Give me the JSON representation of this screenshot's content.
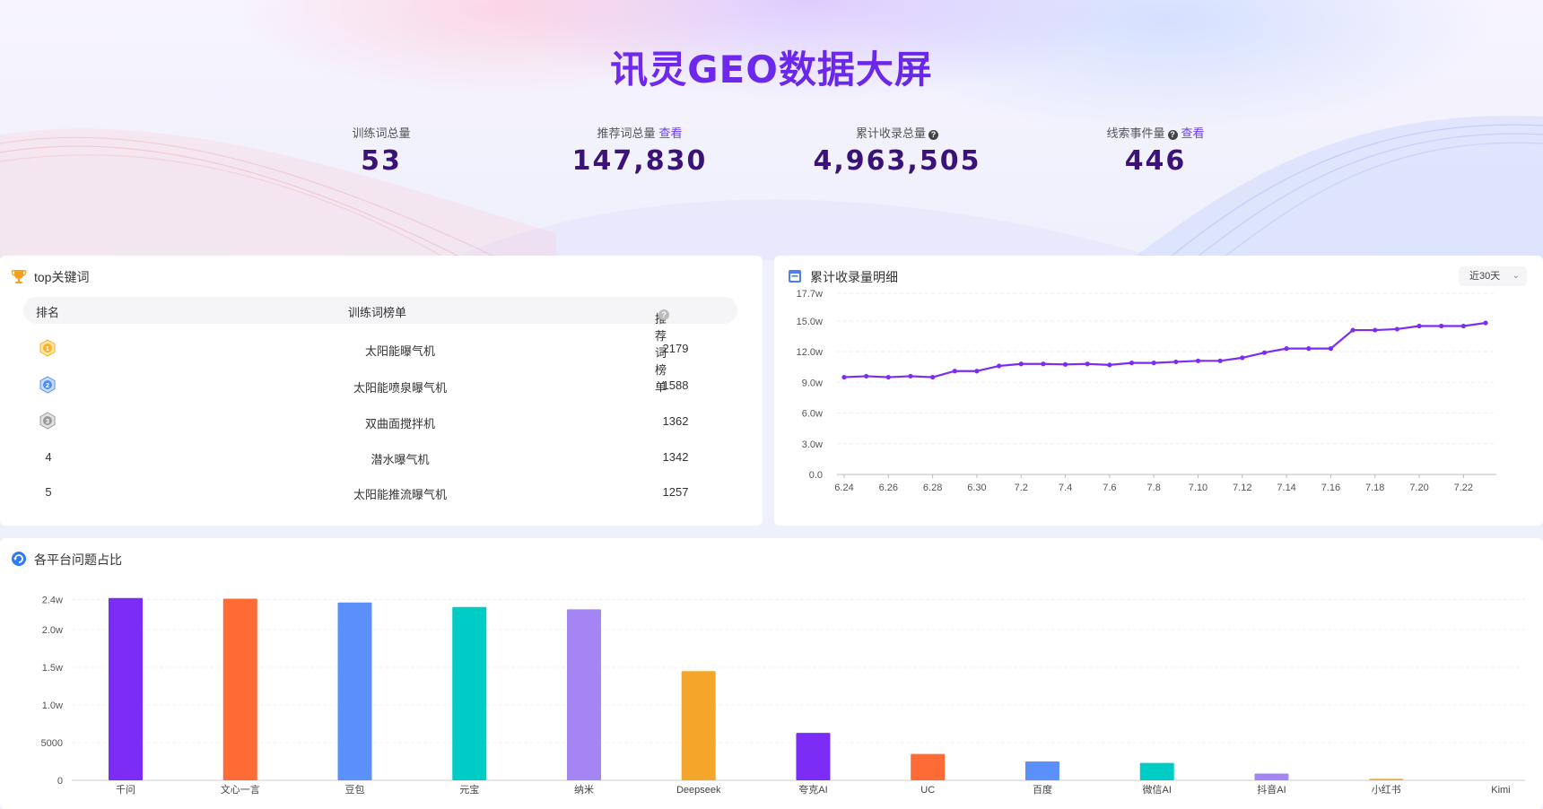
{
  "header": {
    "title": "讯灵GEO数据大屏"
  },
  "stats": [
    {
      "label": "训练词总量",
      "value": "53",
      "link": "",
      "help": false
    },
    {
      "label": "推荐词总量",
      "value": "147,830",
      "link": "查看",
      "help": false
    },
    {
      "label": "累计收录总量",
      "value": "4,963,505",
      "link": "",
      "help": true
    },
    {
      "label": "线索事件量",
      "value": "446",
      "link": "查看",
      "help": true
    }
  ],
  "keywords": {
    "title": "top关键词",
    "columns": {
      "rank": "排名",
      "word": "训练词榜单",
      "count": "推荐词榜单"
    },
    "rows": [
      {
        "rank": "1",
        "word": "太阳能曝气机",
        "count": "2179"
      },
      {
        "rank": "2",
        "word": "太阳能喷泉曝气机",
        "count": "1588"
      },
      {
        "rank": "3",
        "word": "双曲面搅拌机",
        "count": "1362"
      },
      {
        "rank": "4",
        "word": "潜水曝气机",
        "count": "1342"
      },
      {
        "rank": "5",
        "word": "太阳能推流曝气机",
        "count": "1257"
      }
    ],
    "medal_colors": [
      "#f3b42a",
      "#4f8ff0",
      "#9a9a9a"
    ]
  },
  "line_card": {
    "title": "累计收录量明细",
    "range_label": "近30天"
  },
  "bar_card": {
    "title": "各平台问题占比"
  },
  "chart_data": [
    {
      "type": "line",
      "title": "累计收录量明细",
      "x_ticks": [
        "6.24",
        "6.26",
        "6.28",
        "6.30",
        "7.2",
        "7.4",
        "7.6",
        "7.8",
        "7.10",
        "7.12",
        "7.14",
        "7.16",
        "7.18",
        "7.20",
        "7.22"
      ],
      "y_ticks": [
        "0.0",
        "3.0w",
        "6.0w",
        "9.0w",
        "12.0w",
        "15.0w",
        "17.7w"
      ],
      "ylim": [
        0,
        177000
      ],
      "color": "#7b2cf5",
      "values": [
        95000,
        96000,
        95000,
        96000,
        95000,
        101000,
        101000,
        106000,
        108000,
        108000,
        107500,
        108000,
        107000,
        109000,
        109000,
        110000,
        111000,
        111000,
        114000,
        119000,
        123000,
        123000,
        123000,
        141000,
        141000,
        142000,
        145000,
        145000,
        145000,
        148000
      ],
      "grid": true
    },
    {
      "type": "bar",
      "title": "各平台问题占比",
      "categories": [
        "千问",
        "文心一言",
        "豆包",
        "元宝",
        "纳米",
        "Deepseek",
        "夸克AI",
        "UC",
        "百度",
        "微信AI",
        "抖音AI",
        "小红书",
        "Kimi"
      ],
      "values": [
        24200,
        24100,
        23600,
        23000,
        22700,
        14500,
        6300,
        3500,
        2500,
        2300,
        900,
        200,
        0
      ],
      "colors": [
        "#7b2cf5",
        "#ff6b35",
        "#5b8ff9",
        "#00ccc6",
        "#a585f4",
        "#f4a62a",
        "#7b2cf5",
        "#ff6b35",
        "#5b8ff9",
        "#00ccc6",
        "#a585f4",
        "#f4a62a",
        "#7b2cf5"
      ],
      "y_ticks": [
        "0",
        "5000",
        "1.0w",
        "1.5w",
        "2.0w",
        "2.4w"
      ],
      "ylim": [
        0,
        25000
      ],
      "grid": true
    }
  ]
}
